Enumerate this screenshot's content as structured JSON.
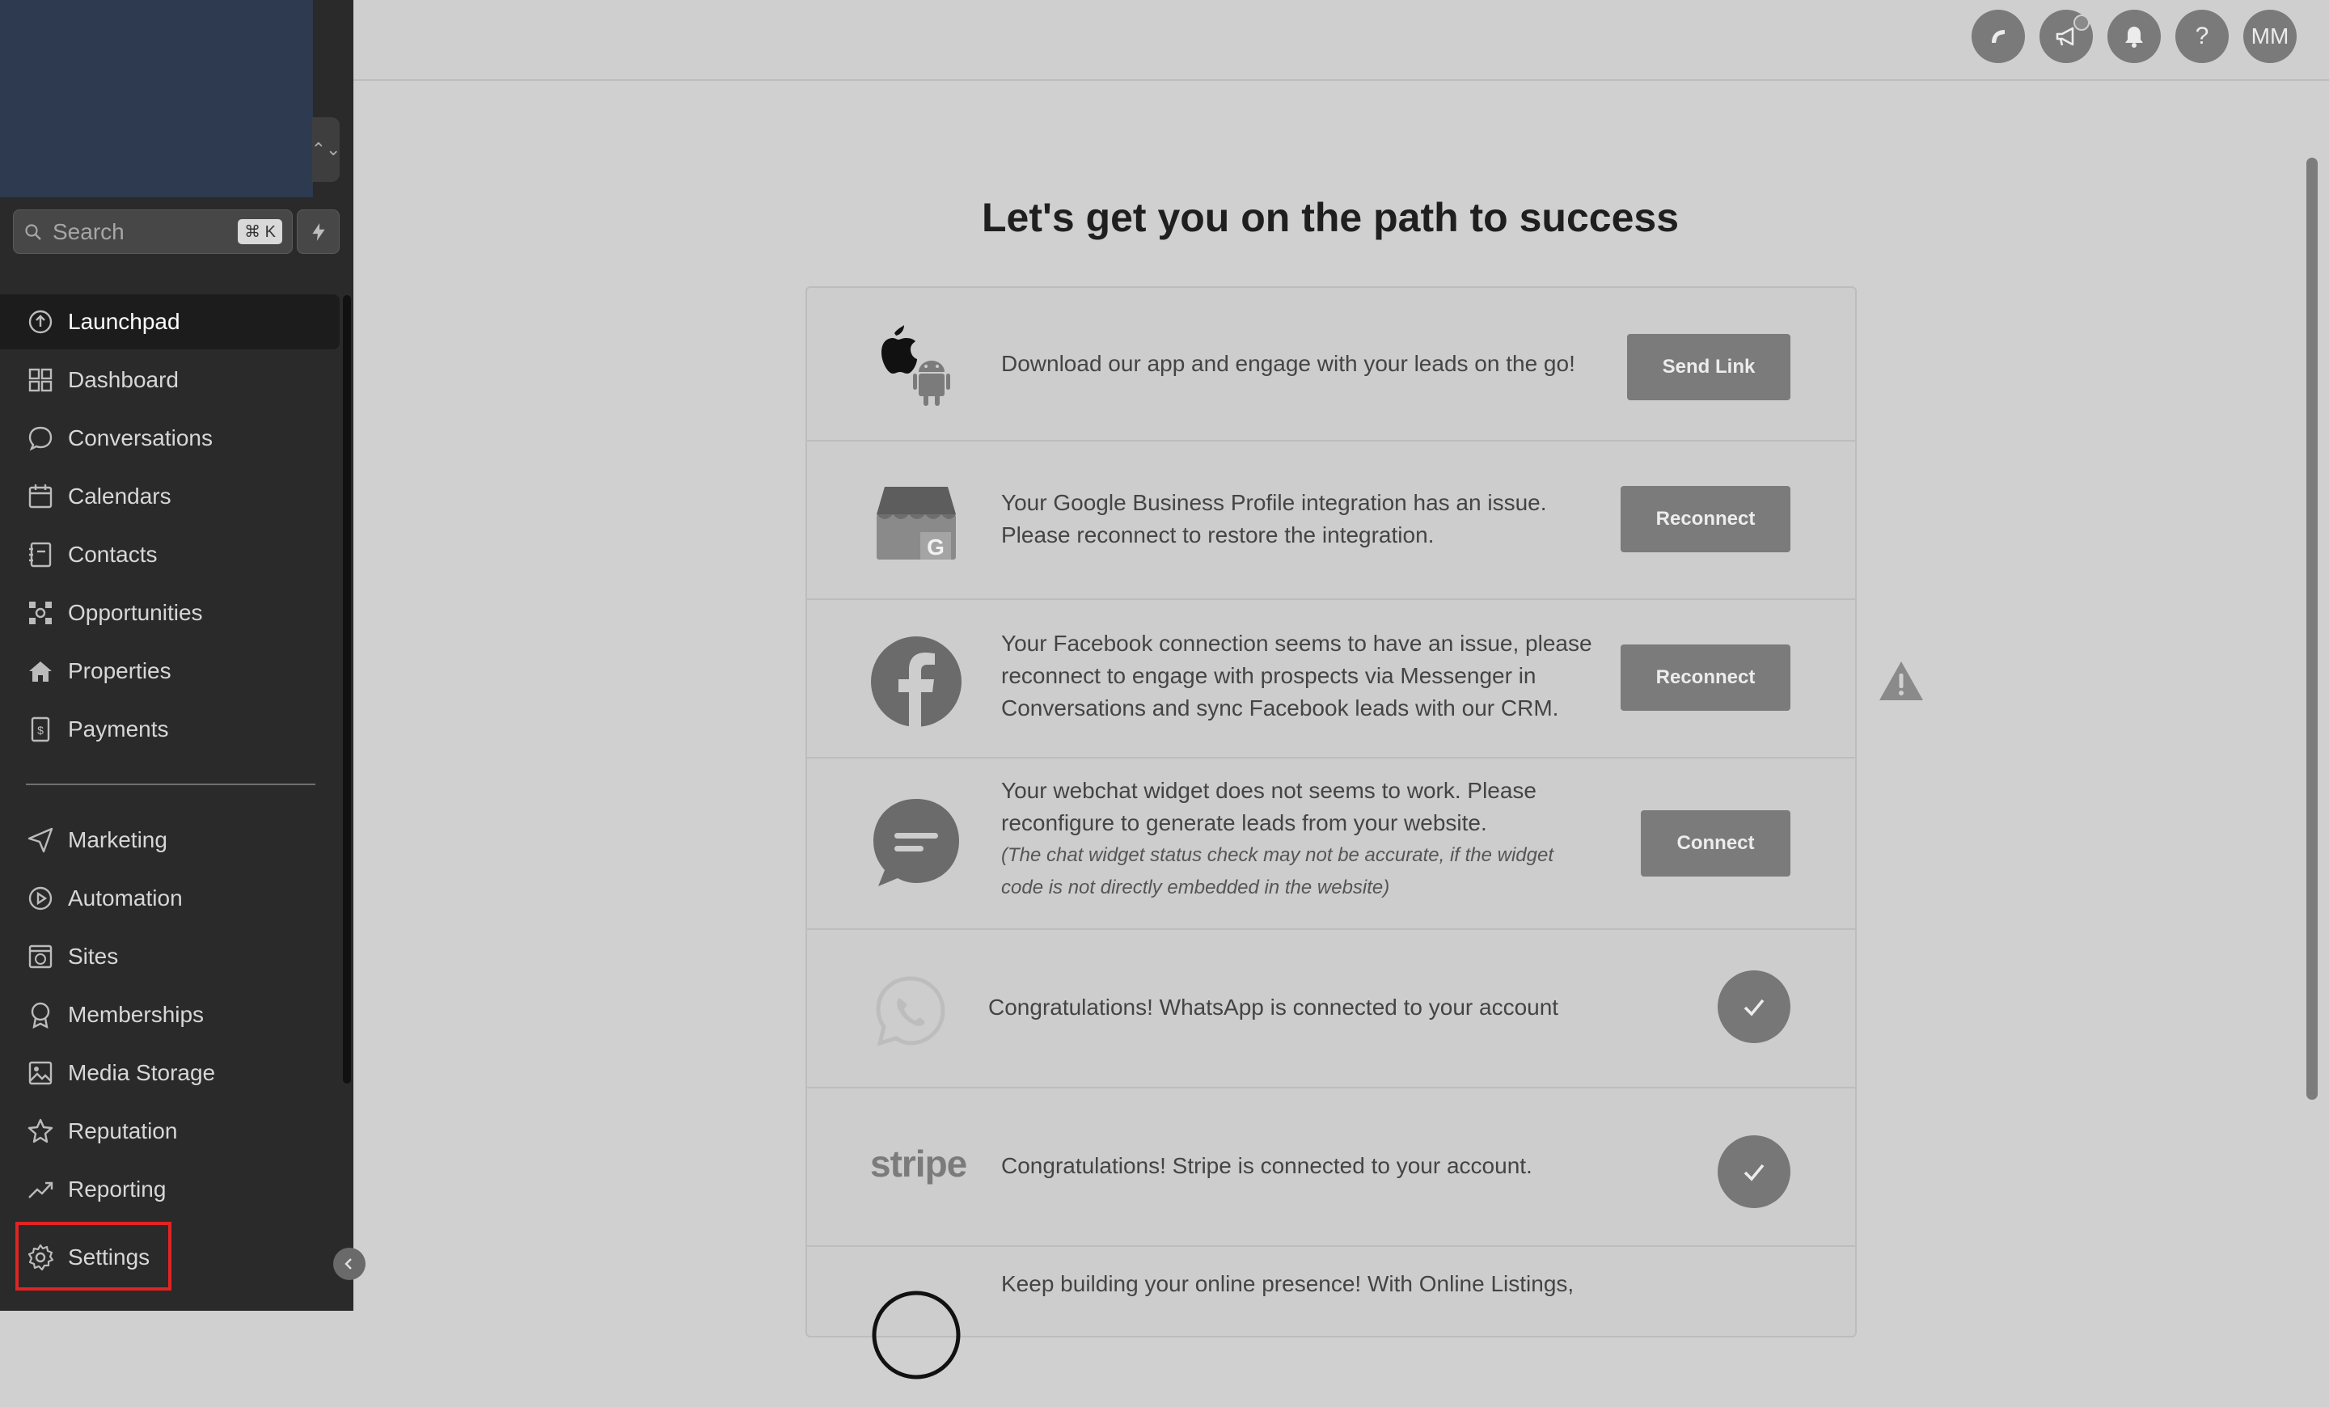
{
  "sidebar": {
    "switcher_glyph": "⌃⌄",
    "search": {
      "placeholder": "Search",
      "shortcut": "⌘ K"
    },
    "nav_primary": [
      {
        "label": "Launchpad",
        "icon": "launchpad-icon",
        "active": true
      },
      {
        "label": "Dashboard",
        "icon": "dashboard-icon"
      },
      {
        "label": "Conversations",
        "icon": "chat-icon"
      },
      {
        "label": "Calendars",
        "icon": "calendar-icon"
      },
      {
        "label": "Contacts",
        "icon": "contacts-icon"
      },
      {
        "label": "Opportunities",
        "icon": "opportunities-icon"
      },
      {
        "label": "Properties",
        "icon": "home-icon"
      },
      {
        "label": "Payments",
        "icon": "payments-icon"
      }
    ],
    "nav_secondary": [
      {
        "label": "Marketing",
        "icon": "send-icon"
      },
      {
        "label": "Automation",
        "icon": "automation-icon"
      },
      {
        "label": "Sites",
        "icon": "sites-icon"
      },
      {
        "label": "Memberships",
        "icon": "badge-icon"
      },
      {
        "label": "Media Storage",
        "icon": "image-icon"
      },
      {
        "label": "Reputation",
        "icon": "star-icon"
      },
      {
        "label": "Reporting",
        "icon": "trend-icon"
      }
    ],
    "settings": {
      "label": "Settings",
      "icon": "gear-icon",
      "highlight_color": "#e02424"
    }
  },
  "topbar": {
    "icons": [
      "phone-icon",
      "megaphone-icon",
      "bell-icon",
      "help-icon",
      "avatar"
    ],
    "help_glyph": "?",
    "avatar_initials": "MM"
  },
  "main": {
    "title": "Let's get you on the path to success",
    "rows": [
      {
        "text": "Download our app and engage with your leads on the go!",
        "button": "Send Link",
        "icon": "apple-android-icon"
      },
      {
        "text_line1": "Your Google Business Profile integration has an issue.",
        "text_line2": "Please reconnect to restore the integration.",
        "button": "Reconnect",
        "icon": "google-business-icon"
      },
      {
        "text_line1": "Your Facebook connection seems to have an issue, please",
        "text_line2": "reconnect to engage with prospects via Messenger in",
        "text_line3": "Conversations and sync Facebook leads with our CRM.",
        "button": "Reconnect",
        "icon": "facebook-icon"
      },
      {
        "text_line1": "Your webchat widget does not seems to work. Please",
        "text_line2": "reconfigure to generate leads from your website.",
        "note_line1": "(The chat widget status check may not be accurate, if the widget",
        "note_line2": "code is not directly embedded in the website)",
        "button": "Connect",
        "icon": "webchat-icon"
      },
      {
        "text": "Congratulations! WhatsApp is connected to your account",
        "status": "connected",
        "icon": "whatsapp-icon"
      },
      {
        "text": "Congratulations! Stripe is connected to your account.",
        "status": "connected",
        "icon": "stripe-logo",
        "logo_text": "stripe"
      },
      {
        "text_line1": "Keep building your online presence! With Online Listings,",
        "icon": "listings-icon"
      }
    ]
  },
  "colors": {
    "sidebar_bg": "#2a2a2a",
    "main_bg": "#d0d0d0",
    "button_bg": "#7b7b7b"
  }
}
